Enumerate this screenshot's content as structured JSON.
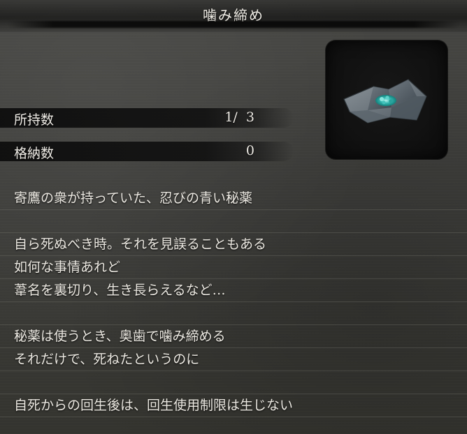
{
  "title": "噛み締め",
  "stats": {
    "held": {
      "label": "所持数",
      "value": "1/  3"
    },
    "stored": {
      "label": "格納数",
      "value": "0"
    }
  },
  "item": {
    "icon": "folded-paper-packet-icon"
  },
  "description": {
    "line1": "寄鷹の衆が持っていた、忍びの青い秘薬",
    "line2": "自ら死ぬべき時。それを見誤ることもある",
    "line3": "如何な事情あれど",
    "line4": "葦名を裏切り、生き長らえるなど…",
    "line5": "秘薬は使うとき、奥歯で噛み締める",
    "line6": "それだけで、死ねたというのに",
    "line7": "自死からの回生後は、回生使用制限は生じない"
  },
  "colors": {
    "background": "#3c3c39",
    "text": "#ece9e2",
    "accent_teal": "#33b7b0"
  }
}
